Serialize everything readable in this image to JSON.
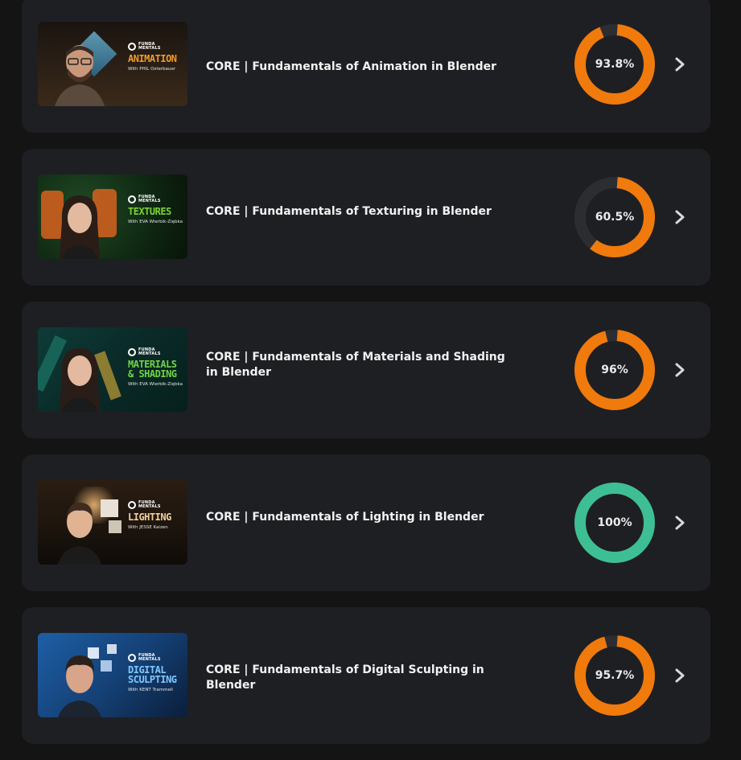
{
  "colors": {
    "progress_partial": "#f07a0c",
    "progress_complete": "#3dbf93",
    "ring_track": "#2c2d31"
  },
  "courses": [
    {
      "title": "CORE | Fundamentals of Animation in Blender",
      "progress_label": "93.8%",
      "progress": 0.938,
      "thumbnail": {
        "logo_text_1": "FUNDA",
        "logo_text_2": "MENTALS",
        "subject": "ANIMATION",
        "subject_color": "#f19a2a",
        "presenter": "With PHIL Osterbauer",
        "scene": "dark-wood"
      }
    },
    {
      "title": "CORE | Fundamentals of Texturing in Blender",
      "progress_label": "60.5%",
      "progress": 0.605,
      "thumbnail": {
        "logo_text_1": "FUNDA",
        "logo_text_2": "MENTALS",
        "subject": "TEXTURES",
        "subject_color": "#7dd23a",
        "presenter": "With EVA Wierbik-Ziębka",
        "scene": "green-orange"
      }
    },
    {
      "title": "CORE | Fundamentals of Materials and Shading in Blender",
      "progress_label": "96%",
      "progress": 0.96,
      "thumbnail": {
        "logo_text_1": "FUNDA",
        "logo_text_2": "MENTALS",
        "subject": "MATERIALS\n& SHADING",
        "subject_color": "#6fd444",
        "presenter": "With EVA Wierbik-Ziębka",
        "scene": "teal-crystal"
      }
    },
    {
      "title": "CORE | Fundamentals of Lighting in Blender",
      "progress_label": "100%",
      "progress": 1.0,
      "thumbnail": {
        "logo_text_1": "FUNDA",
        "logo_text_2": "MENTALS",
        "subject": "LIGHTING",
        "subject_color": "#f2d09a",
        "presenter": "With JESSE Kaizen",
        "scene": "warm-room"
      }
    },
    {
      "title": "CORE | Fundamentals of Digital Sculpting in Blender",
      "progress_label": "95.7%",
      "progress": 0.957,
      "thumbnail": {
        "logo_text_1": "FUNDA",
        "logo_text_2": "MENTALS",
        "subject": "DIGITAL\nSCULPTING",
        "subject_color": "#7fc8ff",
        "presenter": "With KENT Trammell",
        "scene": "blue-pixels"
      }
    }
  ]
}
